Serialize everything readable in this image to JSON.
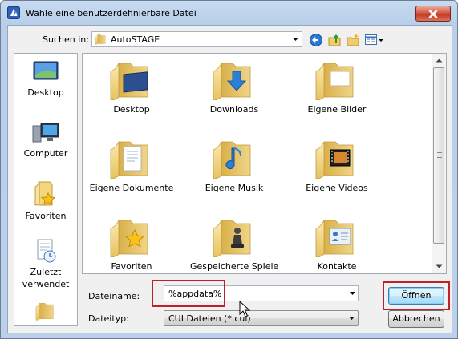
{
  "window": {
    "title": "Wähle eine benutzerdefinierbare Datei",
    "close_icon": "close-icon"
  },
  "toolbar": {
    "lookin_label": "Suchen in:",
    "lookin_value": "AutoSTAGE",
    "icons": [
      "back-icon",
      "up-folder-icon",
      "new-folder-icon",
      "view-menu-icon"
    ]
  },
  "places": [
    {
      "label": "Desktop",
      "icon": "desktop-icon"
    },
    {
      "label": "Computer",
      "icon": "computer-icon"
    },
    {
      "label": "Favoriten",
      "icon": "favorites-icon"
    },
    {
      "label": "Zuletzt verwendet",
      "icon": "recent-icon"
    },
    {
      "label": "",
      "icon": "folder-icon"
    }
  ],
  "files": [
    {
      "label": "Desktop",
      "icon": "desktop-folder-icon"
    },
    {
      "label": "Downloads",
      "icon": "downloads-folder-icon"
    },
    {
      "label": "Eigene Bilder",
      "icon": "pictures-folder-icon"
    },
    {
      "label": "Eigene Dokumente",
      "icon": "documents-folder-icon"
    },
    {
      "label": "Eigene Musik",
      "icon": "music-folder-icon"
    },
    {
      "label": "Eigene Videos",
      "icon": "videos-folder-icon"
    },
    {
      "label": "Favoriten",
      "icon": "favorites-folder-icon"
    },
    {
      "label": "Gespeicherte Spiele",
      "icon": "saved-games-folder-icon"
    },
    {
      "label": "Kontakte",
      "icon": "contacts-folder-icon"
    }
  ],
  "form": {
    "filename_label": "Dateiname:",
    "filename_value": "%appdata%",
    "filetype_label": "Dateityp:",
    "filetype_value": "CUI Dateien (*.cui)"
  },
  "buttons": {
    "open": "Öffnen",
    "cancel": "Abbrechen"
  },
  "colors": {
    "highlight": "#c0202a",
    "folder": "#f2d57a"
  }
}
